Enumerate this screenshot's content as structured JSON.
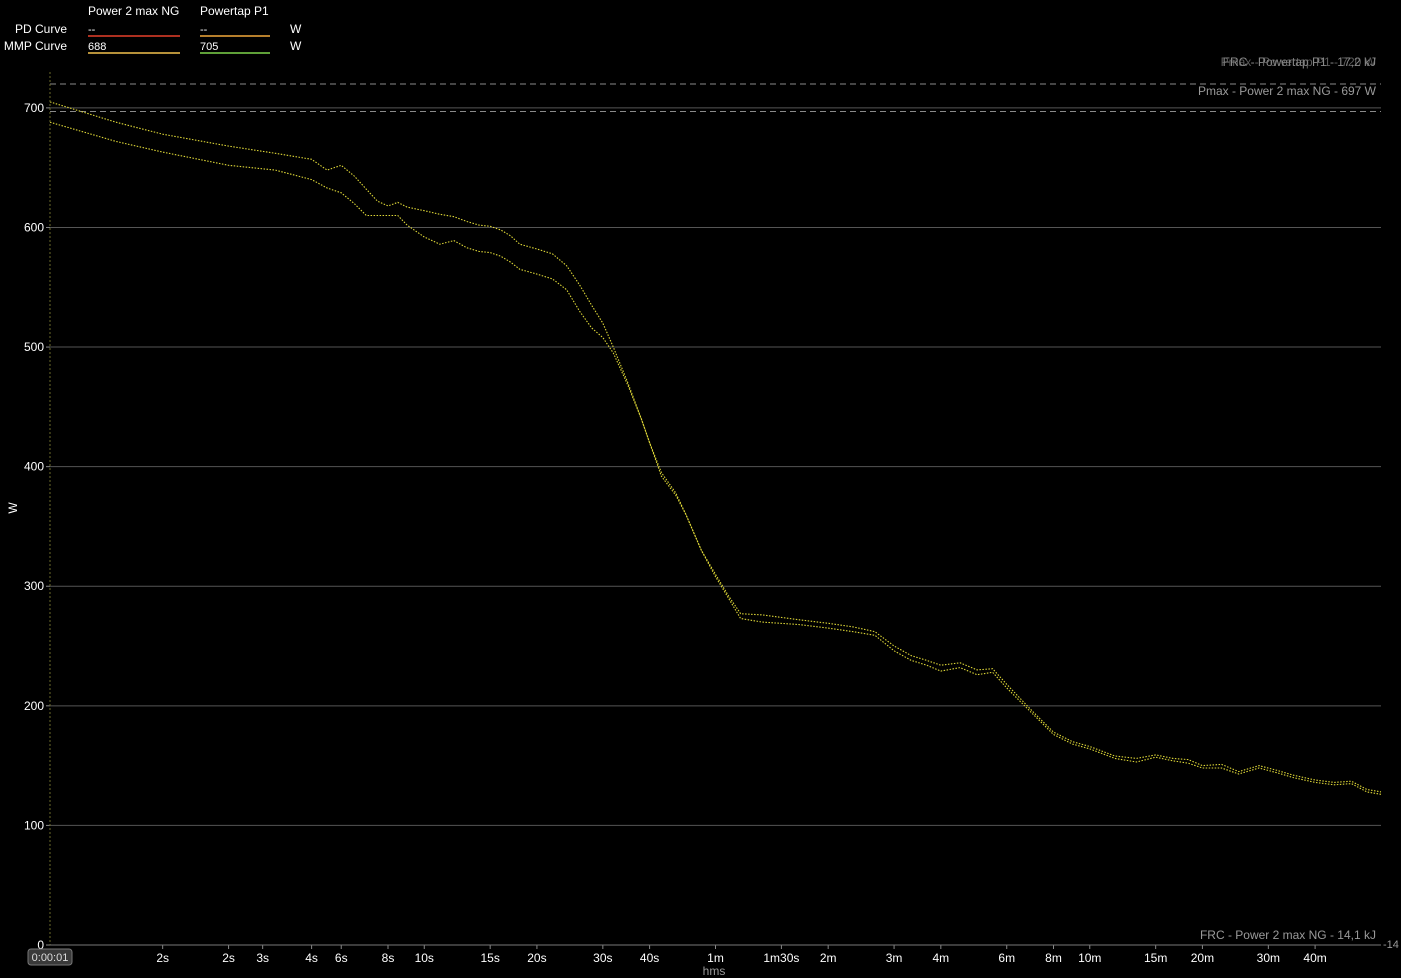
{
  "legend": {
    "series_headers": [
      "Power 2 max NG",
      "Powertap P1"
    ],
    "rows": [
      {
        "label": "PD Curve",
        "values": [
          "--",
          "--"
        ],
        "unit": "W",
        "colors": [
          "#e8402a",
          "#f2a93b"
        ]
      },
      {
        "label": "MMP Curve",
        "values": [
          "688",
          "705"
        ],
        "unit": "W",
        "colors": [
          "#f2c14e",
          "#7fd64a"
        ]
      }
    ]
  },
  "annotations": {
    "frc_overlap": "FRC - Powertap P1 - 17,2 kJ",
    "pmax_overlap": "Pmax - Powertap P1 - 720 W",
    "pmax": "Pmax - Power 2 max NG - 697 W",
    "frc_bottom": "FRC - Power 2 max NG - 14,1 kJ",
    "right_edge_tick": "-14"
  },
  "colors": {
    "background": "#000000",
    "grid": "#555555",
    "axis_text": "#ffffff",
    "annotation_text": "#9a9a9a",
    "curve_dot": "#e9e23a",
    "ref_line": "#8a8a8a",
    "cursor_line": "#6a6a2a"
  },
  "chart_data": {
    "type": "line",
    "xlabel": "hms",
    "ylabel": "W",
    "x_scale": "log",
    "xlim_seconds": [
      1,
      3600
    ],
    "ylim": [
      0,
      730
    ],
    "y_ticks": [
      0,
      100,
      200,
      300,
      400,
      500,
      600,
      700
    ],
    "x_ticks": [
      {
        "label": "0:00:01",
        "seconds": 1,
        "boxed": true
      },
      {
        "label": "2s",
        "seconds": 2
      },
      {
        "label": "2s",
        "seconds": 3
      },
      {
        "label": "3s",
        "seconds": 3.7
      },
      {
        "label": "4s",
        "seconds": 5
      },
      {
        "label": "6s",
        "seconds": 6
      },
      {
        "label": "8s",
        "seconds": 8
      },
      {
        "label": "10s",
        "seconds": 10
      },
      {
        "label": "15s",
        "seconds": 15
      },
      {
        "label": "20s",
        "seconds": 20
      },
      {
        "label": "30s",
        "seconds": 30
      },
      {
        "label": "40s",
        "seconds": 40
      },
      {
        "label": "1m",
        "seconds": 60
      },
      {
        "label": "1m30s",
        "seconds": 90
      },
      {
        "label": "2m",
        "seconds": 120
      },
      {
        "label": "3m",
        "seconds": 180
      },
      {
        "label": "4m",
        "seconds": 240
      },
      {
        "label": "6m",
        "seconds": 360
      },
      {
        "label": "8m",
        "seconds": 480
      },
      {
        "label": "10m",
        "seconds": 600
      },
      {
        "label": "15m",
        "seconds": 900
      },
      {
        "label": "20m",
        "seconds": 1200
      },
      {
        "label": "30m",
        "seconds": 1800
      },
      {
        "label": "40m",
        "seconds": 2400
      }
    ],
    "reference_lines": [
      {
        "name": "Pmax - Powertap P1",
        "value": 720
      },
      {
        "name": "Pmax - Power 2 max NG",
        "value": 697
      }
    ],
    "series": [
      {
        "name": "Powertap P1",
        "points": [
          [
            1,
            705
          ],
          [
            1.5,
            688
          ],
          [
            2,
            678
          ],
          [
            3,
            668
          ],
          [
            4,
            662
          ],
          [
            5,
            657
          ],
          [
            5.5,
            648
          ],
          [
            6,
            652
          ],
          [
            6.5,
            643
          ],
          [
            7,
            632
          ],
          [
            7.5,
            622
          ],
          [
            8,
            618
          ],
          [
            8.5,
            621
          ],
          [
            9,
            617
          ],
          [
            10,
            614
          ],
          [
            11,
            611
          ],
          [
            12,
            609
          ],
          [
            13,
            605
          ],
          [
            14,
            602
          ],
          [
            15,
            601
          ],
          [
            16,
            598
          ],
          [
            17,
            593
          ],
          [
            18,
            586
          ],
          [
            20,
            582
          ],
          [
            22,
            578
          ],
          [
            24,
            568
          ],
          [
            26,
            552
          ],
          [
            28,
            535
          ],
          [
            30,
            520
          ],
          [
            32,
            500
          ],
          [
            35,
            470
          ],
          [
            38,
            440
          ],
          [
            40,
            420
          ],
          [
            43,
            395
          ],
          [
            47,
            378
          ],
          [
            50,
            360
          ],
          [
            55,
            330
          ],
          [
            60,
            310
          ],
          [
            65,
            292
          ],
          [
            70,
            277
          ],
          [
            80,
            276
          ],
          [
            100,
            272
          ],
          [
            120,
            269
          ],
          [
            140,
            266
          ],
          [
            160,
            262
          ],
          [
            180,
            250
          ],
          [
            200,
            242
          ],
          [
            220,
            238
          ],
          [
            240,
            234
          ],
          [
            270,
            236
          ],
          [
            300,
            230
          ],
          [
            330,
            231
          ],
          [
            360,
            218
          ],
          [
            420,
            196
          ],
          [
            480,
            178
          ],
          [
            540,
            170
          ],
          [
            600,
            166
          ],
          [
            700,
            158
          ],
          [
            800,
            156
          ],
          [
            900,
            159
          ],
          [
            1000,
            156
          ],
          [
            1100,
            155
          ],
          [
            1200,
            150
          ],
          [
            1350,
            151
          ],
          [
            1500,
            145
          ],
          [
            1700,
            150
          ],
          [
            1900,
            146
          ],
          [
            2100,
            142
          ],
          [
            2400,
            138
          ],
          [
            2700,
            136
          ],
          [
            3000,
            137
          ],
          [
            3300,
            130
          ],
          [
            3600,
            128
          ]
        ]
      },
      {
        "name": "Power 2 max NG",
        "points": [
          [
            1,
            688
          ],
          [
            1.5,
            672
          ],
          [
            2,
            663
          ],
          [
            3,
            652
          ],
          [
            4,
            648
          ],
          [
            5,
            640
          ],
          [
            5.5,
            633
          ],
          [
            6,
            629
          ],
          [
            6.5,
            620
          ],
          [
            7,
            610
          ],
          [
            8,
            610
          ],
          [
            8.5,
            610
          ],
          [
            9,
            602
          ],
          [
            10,
            592
          ],
          [
            11,
            586
          ],
          [
            12,
            589
          ],
          [
            13,
            583
          ],
          [
            14,
            580
          ],
          [
            15,
            579
          ],
          [
            16,
            576
          ],
          [
            17,
            571
          ],
          [
            18,
            565
          ],
          [
            20,
            561
          ],
          [
            22,
            557
          ],
          [
            24,
            548
          ],
          [
            26,
            530
          ],
          [
            28,
            516
          ],
          [
            30,
            508
          ],
          [
            32,
            495
          ],
          [
            35,
            468
          ],
          [
            38,
            440
          ],
          [
            40,
            420
          ],
          [
            43,
            392
          ],
          [
            47,
            376
          ],
          [
            50,
            360
          ],
          [
            55,
            330
          ],
          [
            60,
            308
          ],
          [
            65,
            290
          ],
          [
            70,
            273
          ],
          [
            80,
            270
          ],
          [
            100,
            268
          ],
          [
            120,
            265
          ],
          [
            140,
            262
          ],
          [
            160,
            259
          ],
          [
            180,
            246
          ],
          [
            200,
            238
          ],
          [
            220,
            234
          ],
          [
            240,
            229
          ],
          [
            270,
            232
          ],
          [
            300,
            226
          ],
          [
            330,
            228
          ],
          [
            360,
            215
          ],
          [
            420,
            194
          ],
          [
            480,
            176
          ],
          [
            540,
            168
          ],
          [
            600,
            164
          ],
          [
            700,
            156
          ],
          [
            800,
            153
          ],
          [
            900,
            157
          ],
          [
            1000,
            154
          ],
          [
            1100,
            152
          ],
          [
            1200,
            148
          ],
          [
            1350,
            148
          ],
          [
            1500,
            143
          ],
          [
            1700,
            148
          ],
          [
            1900,
            144
          ],
          [
            2100,
            140
          ],
          [
            2400,
            136
          ],
          [
            2700,
            134
          ],
          [
            3000,
            135
          ],
          [
            3300,
            128
          ],
          [
            3600,
            126
          ]
        ]
      }
    ]
  }
}
